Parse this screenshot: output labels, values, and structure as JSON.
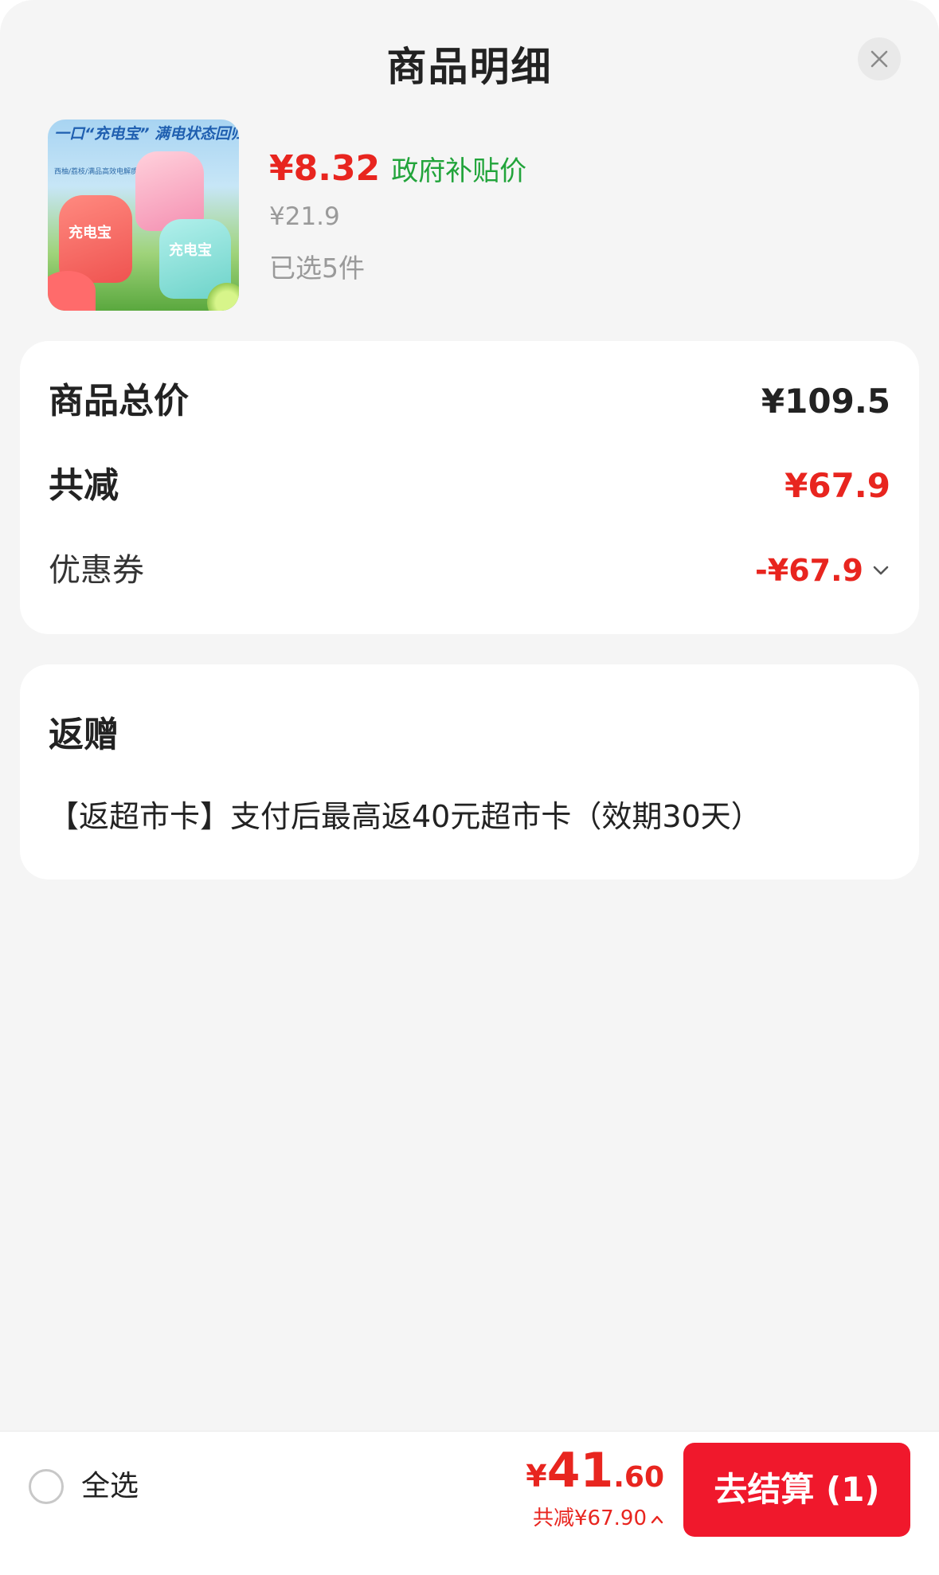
{
  "header": {
    "title": "商品明细",
    "close_icon": "close-icon"
  },
  "product": {
    "image_banner": "一口“充电宝” 满电状态回归",
    "image_subtitle": "西柚/荔枝/满品高效电解质水",
    "image_pouch_label": "充电宝",
    "price": "¥8.32",
    "price_label": "政府补贴价",
    "original_price": "¥21.9",
    "selected_count": "已选5件"
  },
  "summary": {
    "total_label": "商品总价",
    "total_value": "¥109.5",
    "reduce_label": "共减",
    "reduce_value": "¥67.9",
    "coupon_label": "优惠券",
    "coupon_value": "-¥67.9",
    "coupon_chevron": "chevron-down-icon"
  },
  "gift": {
    "title": "返赠",
    "text": "【返超市卡】支付后最高返40元超市卡（效期30天）"
  },
  "footer": {
    "select_all_label": "全选",
    "pay_yen": "¥",
    "pay_int": "41",
    "pay_dec": ".60",
    "pay_reduce": "共减¥67.90",
    "pay_reduce_caret": "chevron-up-icon",
    "checkout_label": "去结算 (1)"
  },
  "colors": {
    "accent_red": "#e8251f",
    "checkout_red": "#f0182c",
    "subsidy_green": "#22a43b",
    "muted_gray": "#9a9a9a",
    "background": "#f5f5f5"
  }
}
